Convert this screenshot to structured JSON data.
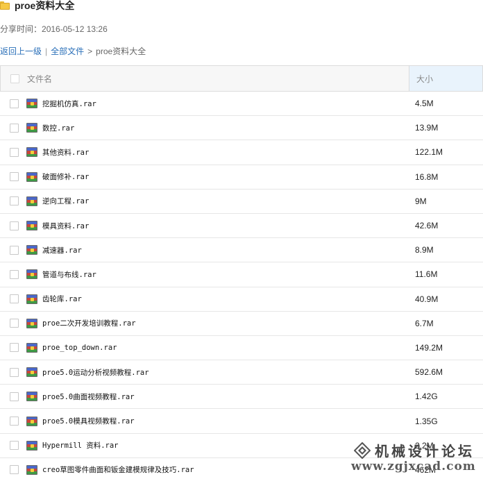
{
  "page": {
    "title": "proe资料大全",
    "share_label": "分享时间：",
    "share_time": "2016-05-12 13:26"
  },
  "breadcrumb": {
    "back": "返回上一级",
    "separator": "|",
    "all_files": "全部文件",
    "arrow": ">",
    "current": "proe资料大全"
  },
  "table": {
    "col_name": "文件名",
    "col_size": "大小",
    "rows": [
      {
        "name": "挖掘机仿真.rar",
        "size": "4.5M"
      },
      {
        "name": "数控.rar",
        "size": "13.9M"
      },
      {
        "name": "其他资料.rar",
        "size": "122.1M"
      },
      {
        "name": "破面修补.rar",
        "size": "16.8M"
      },
      {
        "name": "逆向工程.rar",
        "size": "9M"
      },
      {
        "name": "模具资料.rar",
        "size": "42.6M"
      },
      {
        "name": "减速器.rar",
        "size": "8.9M"
      },
      {
        "name": "管道与布线.rar",
        "size": "11.6M"
      },
      {
        "name": "齿轮库.rar",
        "size": "40.9M"
      },
      {
        "name": "proe二次开发培训教程.rar",
        "size": "6.7M"
      },
      {
        "name": "proe_top_down.rar",
        "size": "149.2M"
      },
      {
        "name": "proe5.0运动分析视频教程.rar",
        "size": "592.6M"
      },
      {
        "name": "proe5.0曲面视频教程.rar",
        "size": "1.42G"
      },
      {
        "name": "proe5.0模具视频教程.rar",
        "size": "1.35G"
      },
      {
        "name": "Hypermill 资料.rar",
        "size": "2.2M"
      },
      {
        "name": "creo草图零件曲面和钣金建模规律及技巧.rar",
        "size": "462M"
      }
    ]
  },
  "watermark": {
    "name": "机械设计论坛",
    "url": "www.zgjxcad.com"
  },
  "icons": {
    "folder": "folder-icon",
    "archive": "rar-archive-icon",
    "logo": "forum-logo-icon"
  }
}
